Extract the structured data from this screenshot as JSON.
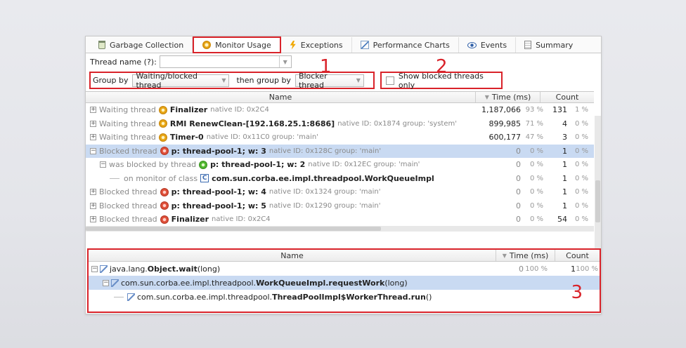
{
  "tabs": [
    {
      "label": "Garbage Collection",
      "icon": "trash-icon"
    },
    {
      "label": "Monitor Usage",
      "icon": "gear-icon"
    },
    {
      "label": "Exceptions",
      "icon": "bolt-icon"
    },
    {
      "label": "Performance Charts",
      "icon": "chart-icon"
    },
    {
      "label": "Events",
      "icon": "eye-icon"
    },
    {
      "label": "Summary",
      "icon": "document-icon"
    }
  ],
  "filter": {
    "thread_name_label": "Thread name (?):",
    "thread_name_value": "",
    "group_by_label": "Group by",
    "group_by_value": "Waiting/blocked thread",
    "then_group_by_label": "then group by",
    "then_group_by_value": "Blocker thread",
    "show_blocked_label": "Show blocked threads only"
  },
  "callouts": [
    "1",
    "2",
    "3"
  ],
  "top_table": {
    "headers": {
      "name": "Name",
      "time": "Time (ms)",
      "count": "Count"
    },
    "rows": [
      {
        "prefix": "Waiting thread",
        "name": "Finalizer",
        "meta": "native ID: 0x2C4",
        "time": "1,187,066",
        "pct": "93 %",
        "count": "131",
        "cpct": "1 %"
      },
      {
        "prefix": "Waiting thread",
        "name": "RMI RenewClean-[192.168.25.1:8686]",
        "meta": "native ID: 0x1874  group: 'system'",
        "time": "899,985",
        "pct": "71 %",
        "count": "4",
        "cpct": "0 %"
      },
      {
        "prefix": "Waiting thread",
        "name": "Timer-0",
        "meta": "native ID: 0x11C0  group: 'main'",
        "time": "600,177",
        "pct": "47 %",
        "count": "3",
        "cpct": "0 %"
      },
      {
        "prefix": "Blocked thread",
        "name": "p: thread-pool-1; w: 3",
        "meta": "native ID: 0x128C  group: 'main'",
        "time": "0",
        "pct": "0 %",
        "count": "1",
        "cpct": "0 %"
      },
      {
        "prefix": "was blocked by thread",
        "name": "p: thread-pool-1; w: 2",
        "meta": "native ID: 0x12EC  group: 'main'",
        "time": "0",
        "pct": "0 %",
        "count": "1",
        "cpct": "0 %"
      },
      {
        "prefix": "on monitor of class",
        "name": "com.sun.corba.ee.impl.threadpool.WorkQueueImpl",
        "meta": "",
        "time": "0",
        "pct": "0 %",
        "count": "1",
        "cpct": "0 %"
      },
      {
        "prefix": "Blocked thread",
        "name": "p: thread-pool-1; w: 4",
        "meta": "native ID: 0x1324  group: 'main'",
        "time": "0",
        "pct": "0 %",
        "count": "1",
        "cpct": "0 %"
      },
      {
        "prefix": "Blocked thread",
        "name": "p: thread-pool-1; w: 5",
        "meta": "native ID: 0x1290  group: 'main'",
        "time": "0",
        "pct": "0 %",
        "count": "1",
        "cpct": "0 %"
      },
      {
        "prefix": "Blocked thread",
        "name": "Finalizer",
        "meta": "native ID: 0x2C4",
        "time": "0",
        "pct": "0 %",
        "count": "54",
        "cpct": "0 %"
      }
    ]
  },
  "bottom_table": {
    "headers": {
      "name": "Name",
      "time": "Time (ms)",
      "count": "Count"
    },
    "rows": [
      {
        "pkg": "java.lang.",
        "method": "Object.wait",
        "args": "(long)",
        "time": "0",
        "pct": "100 %",
        "count": "1",
        "cpct": "100 %"
      },
      {
        "pkg": "com.sun.corba.ee.impl.threadpool.",
        "method": "WorkQueueImpl.requestWork",
        "args": "(long)",
        "time": "",
        "pct": "",
        "count": "",
        "cpct": ""
      },
      {
        "pkg": "com.sun.corba.ee.impl.threadpool.",
        "method": "ThreadPoolImpl$WorkerThread.run",
        "args": "()",
        "time": "",
        "pct": "",
        "count": "",
        "cpct": ""
      }
    ]
  },
  "colors": {
    "highlight": "#d9232a",
    "selection": "#c9daf2"
  }
}
